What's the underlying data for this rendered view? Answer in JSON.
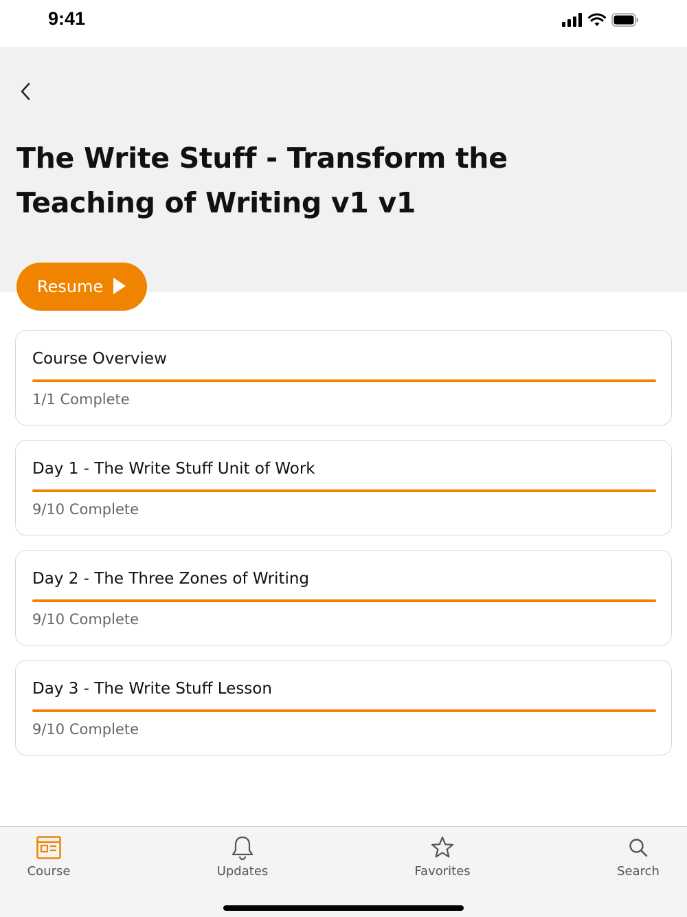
{
  "status_bar": {
    "time": "9:41"
  },
  "header": {
    "title": "The Write Stuff - Transform the Teaching of Writing v1 v1",
    "resume_label": "Resume"
  },
  "modules": [
    {
      "title": "Course Overview",
      "status": "1/1 Complete",
      "progress": 1.0
    },
    {
      "title": "Day 1 - The Write Stuff Unit of Work",
      "status": "9/10 Complete",
      "progress": 1.0
    },
    {
      "title": "Day 2 - The Three Zones of Writing",
      "status": "9/10 Complete",
      "progress": 1.0
    },
    {
      "title": "Day 3 - The Write Stuff Lesson",
      "status": "9/10 Complete",
      "progress": 1.0
    }
  ],
  "tabs": [
    {
      "label": "Course",
      "icon": "course-icon",
      "active": true
    },
    {
      "label": "Updates",
      "icon": "bell-icon",
      "active": false
    },
    {
      "label": "Favorites",
      "icon": "star-icon",
      "active": false
    },
    {
      "label": "Search",
      "icon": "search-icon",
      "active": false
    }
  ],
  "colors": {
    "accent": "#f08300",
    "header_bg": "#f1f1f1",
    "tab_bar_bg": "#f4f4f4",
    "inactive_icon": "#555555"
  }
}
